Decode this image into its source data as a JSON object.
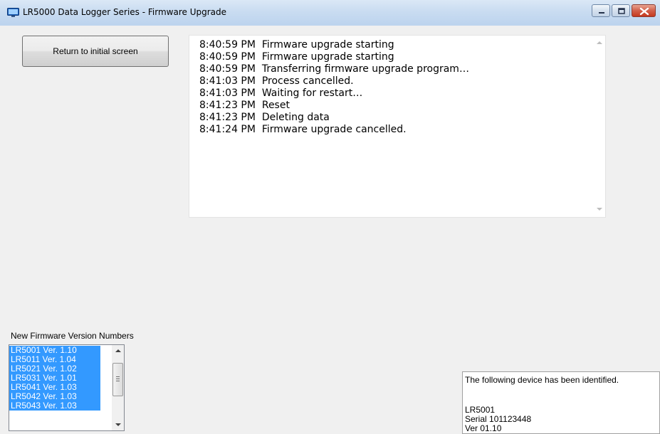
{
  "window": {
    "title": "LR5000 Data Logger Series - Firmware Upgrade",
    "icons": {
      "app": "monitor-icon",
      "minimize": "minimize-icon",
      "maximize": "maximize-icon",
      "close": "close-icon"
    },
    "colors": {
      "selection": "#3399ff",
      "close_button": "#c5391e"
    }
  },
  "buttons": {
    "return_label": "Return to initial screen"
  },
  "log": {
    "lines": [
      "8:40:59 PM  Firmware upgrade starting",
      "8:40:59 PM  Firmware upgrade starting",
      "8:40:59 PM  Transferring firmware upgrade program…",
      "8:41:03 PM  Process cancelled.",
      "8:41:03 PM  Waiting for restart…",
      "8:41:23 PM  Reset",
      "8:41:23 PM  Deleting data",
      "8:41:24 PM  Firmware upgrade cancelled."
    ]
  },
  "firmware": {
    "label": "New Firmware Version Numbers",
    "items": [
      "LR5001 Ver. 1.10",
      "LR5011 Ver. 1.04",
      "LR5021 Ver. 1.02",
      "LR5031 Ver. 1.01",
      "LR5041 Ver. 1.03",
      "LR5042 Ver. 1.03",
      "LR5043 Ver. 1.03"
    ]
  },
  "device": {
    "heading": "The following device has been identified.",
    "model": "LR5001",
    "serial": "Serial 101123448",
    "version": "Ver 01.10"
  }
}
